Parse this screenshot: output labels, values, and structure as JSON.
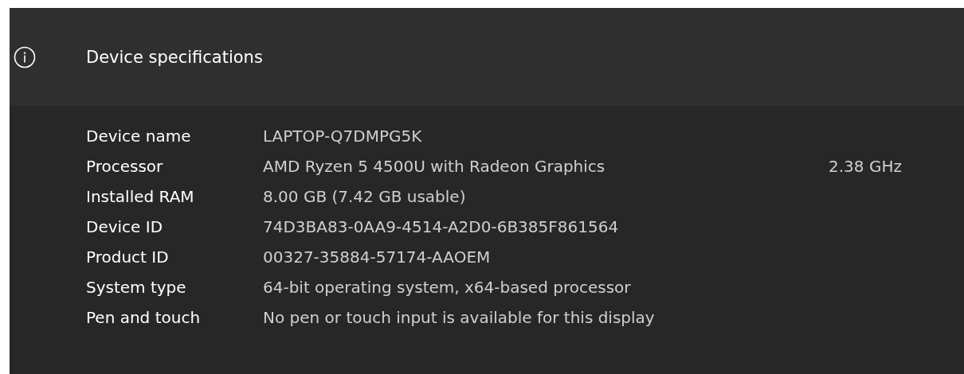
{
  "section": {
    "title": "Device specifications"
  },
  "specs": [
    {
      "label": "Device name",
      "value": "LAPTOP-Q7DMPG5K"
    },
    {
      "label": "Processor",
      "value": "AMD Ryzen 5 4500U with Radeon Graphics",
      "column_3": "2.38 GHz"
    },
    {
      "label": "Installed RAM",
      "value": "8.00 GB (7.42 GB usable)"
    },
    {
      "label": "Device ID",
      "value": "74D3BA83-0AA9-4514-A2D0-6B385F861564"
    },
    {
      "label": "Product ID",
      "value": "00327-35884-57174-AAOEM"
    },
    {
      "label": "System type",
      "value": "64-bit operating system, x64-based processor"
    },
    {
      "label": "Pen and touch",
      "value": "No pen or touch input is available for this display"
    }
  ]
}
